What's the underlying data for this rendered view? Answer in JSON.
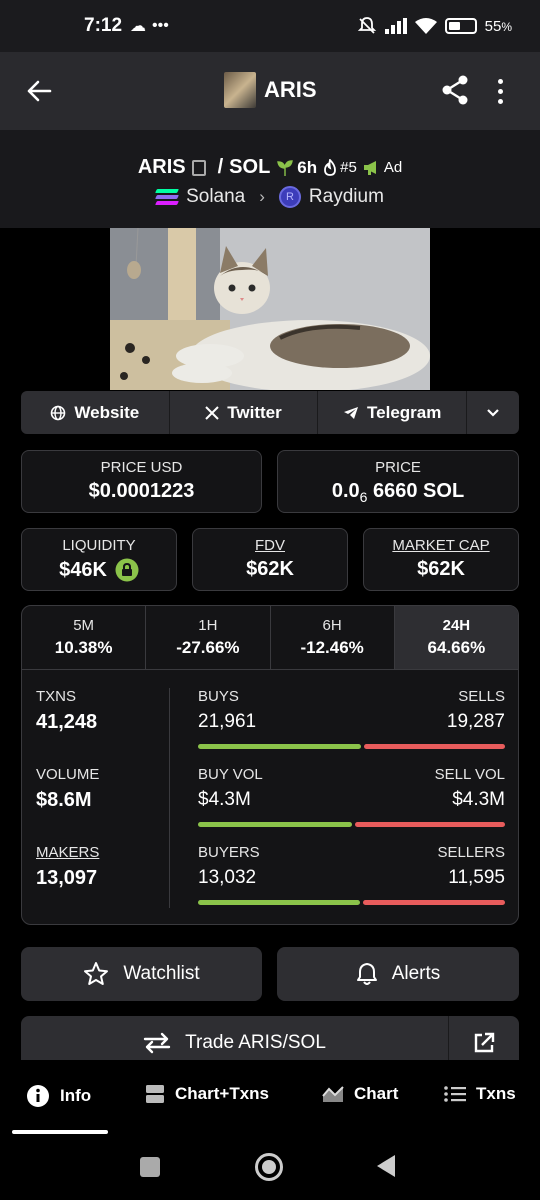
{
  "status_bar": {
    "time": "7:12",
    "battery": "55",
    "battery_unit": "%",
    "battery_level": 0.55
  },
  "app_bar": {
    "title": "ARIS"
  },
  "pair": {
    "base": "ARIS",
    "separator": "/",
    "quote": "SOL",
    "age": "6h",
    "rank": "#5",
    "ad_label": "Ad",
    "chain": "Solana",
    "dex": "Raydium",
    "sol_colors": [
      "#00ffa3",
      "#8f6cf0",
      "#dc1fff"
    ]
  },
  "links": {
    "website": "Website",
    "twitter": "Twitter",
    "telegram": "Telegram"
  },
  "prices": {
    "price_usd_label": "PRICE USD",
    "price_usd": "$0.0001223",
    "price_label": "PRICE",
    "price_prefix": "0.0",
    "price_sub": "6",
    "price_rest": "6660 SOL"
  },
  "metrics": {
    "liquidity_label": "LIQUIDITY",
    "liquidity": "$46K",
    "fdv_label": "FDV",
    "fdv": "$62K",
    "mcap_label": "MARKET CAP",
    "mcap": "$62K"
  },
  "changes": [
    {
      "label": "5M",
      "value": "10.38%"
    },
    {
      "label": "1H",
      "value": "-27.66%"
    },
    {
      "label": "6H",
      "value": "-12.46%"
    },
    {
      "label": "24H",
      "value": "64.66%"
    }
  ],
  "stats": {
    "txns_label": "TXNS",
    "txns": "41,248",
    "volume_label": "VOLUME",
    "volume": "$8.6M",
    "makers_label": "MAKERS",
    "makers": "13,097",
    "buys_label": "BUYS",
    "buys": "21,961",
    "sells_label": "SELLS",
    "sells": "19,287",
    "buys_ratio": 0.532,
    "buy_vol_label": "BUY VOL",
    "buy_vol": "$4.3M",
    "sell_vol_label": "SELL VOL",
    "sell_vol": "$4.3M",
    "buy_vol_ratio": 0.5,
    "buyers_label": "BUYERS",
    "buyers": "13,032",
    "sellers_label": "SELLERS",
    "sellers": "11,595",
    "buyers_ratio": 0.529
  },
  "actions": {
    "watchlist": "Watchlist",
    "alerts": "Alerts",
    "trade": "Trade ARIS/SOL"
  },
  "bottom_nav": {
    "info": "Info",
    "chart_txns": "Chart+Txns",
    "chart": "Chart",
    "txns": "Txns"
  },
  "colors": {
    "buy": "#8bc34a",
    "sell": "#e85c5c",
    "lock": "#8bc34a",
    "age": "#8bc34a",
    "rank_fire": "#ffffff",
    "ad": "#8bc34a"
  }
}
